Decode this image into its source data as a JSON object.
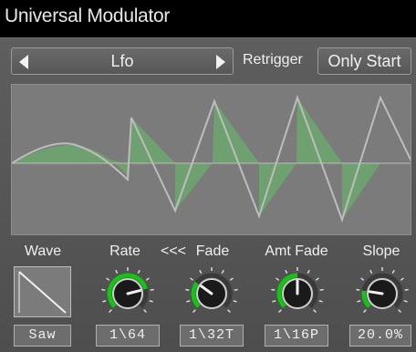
{
  "window": {
    "title": "Universal Modulator"
  },
  "selector": {
    "value": "Lfo",
    "prev_icon": "triangle-left",
    "next_icon": "triangle-right"
  },
  "retrigger": {
    "label": "Retrigger",
    "value": "Only Start"
  },
  "params": {
    "wave": {
      "label": "Wave",
      "value": "Saw",
      "icon": "saw-wave-icon"
    },
    "rate": {
      "label": "Rate",
      "value": "1\\64",
      "level": 0.78
    },
    "arrows": {
      "label": "<<<"
    },
    "fade": {
      "label": "Fade",
      "value": "1\\32T",
      "level": 0.3
    },
    "amt_fade": {
      "label": "Amt Fade",
      "value": "1\\16P",
      "level": 0.5
    },
    "slope": {
      "label": "Slope",
      "value": "20.0%",
      "level": 0.2
    }
  },
  "colors": {
    "accent": "#17c217",
    "fill": "#6fa06f",
    "line": "#bdbdbd",
    "background": "#5a5a5a"
  }
}
